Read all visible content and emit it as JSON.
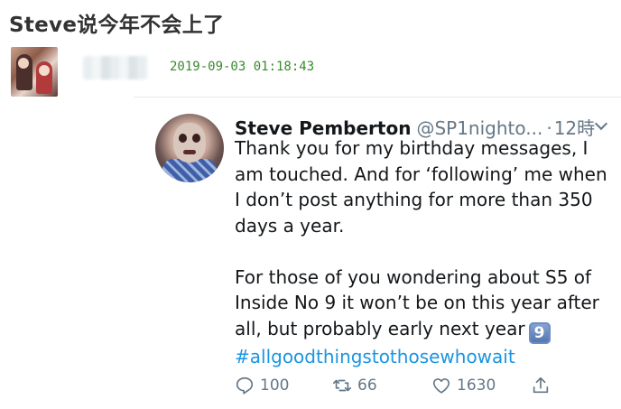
{
  "post": {
    "title": "Steve说今年不会上了",
    "timestamp": "2019-09-03 01:18:43"
  },
  "tweet": {
    "author_name": "Steve Pemberton",
    "handle": "@SP1nighto...",
    "separator": "·",
    "age": "12時",
    "lines_p1": [
      "Thank you for my birthday messages, I",
      "am touched. And for ‘following’ me when",
      "I don’t post anything for more than 350",
      "days a year."
    ],
    "lines_p2": [
      "For those of you wondering about S5 of",
      "Inside No 9 it won’t be on this year after",
      "all, but probably early next year"
    ],
    "emoji_keycap": "9",
    "hashtag": "#allgoodthingstothosewhowait",
    "replies": "100",
    "retweets": "66",
    "likes": "1630"
  },
  "colors": {
    "timestamp": "#3a8a2e",
    "hashtag": "#1b95e0",
    "secondary_text": "#657786"
  },
  "icons": {
    "reply": "reply-icon",
    "retweet": "retweet-icon",
    "like": "heart-icon",
    "share": "share-icon",
    "menu": "chevron-down-icon"
  }
}
